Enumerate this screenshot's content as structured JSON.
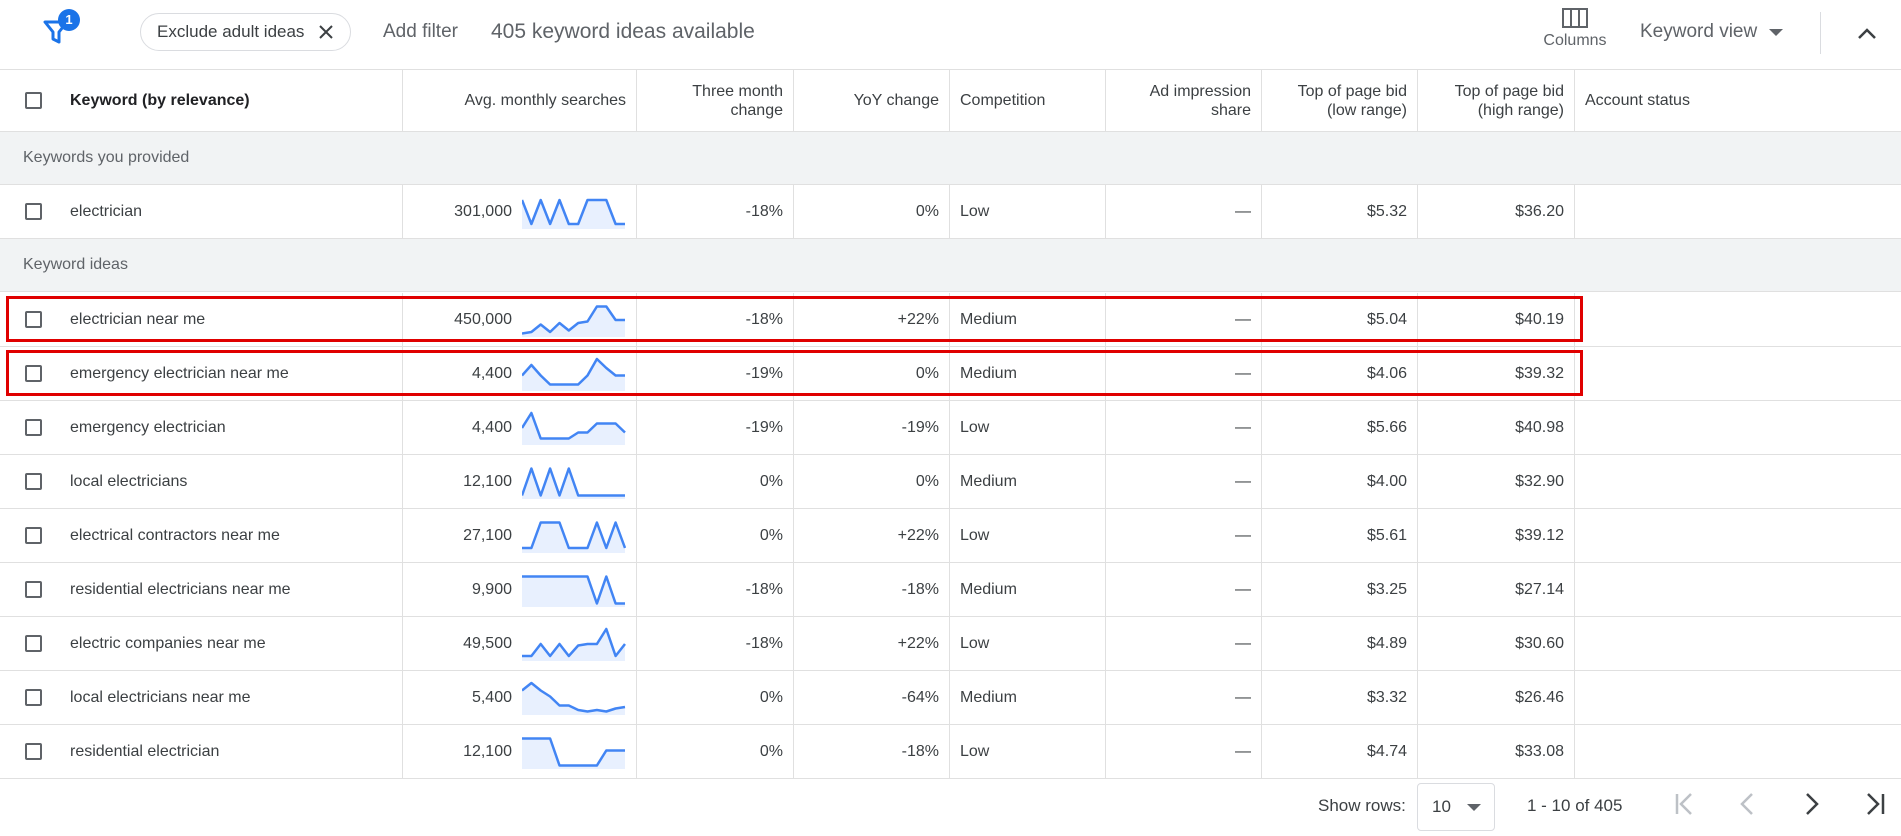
{
  "filterbar": {
    "badge_count": "1",
    "chip_label": "Exclude adult ideas",
    "add_filter": "Add filter",
    "available": "405 keyword ideas available",
    "columns_label": "Columns",
    "keyword_view": "Keyword view"
  },
  "columns": {
    "keyword": "Keyword (by relevance)",
    "avg_searches": "Avg. monthly searches",
    "three_month": "Three month change",
    "yoy": "YoY change",
    "competition": "Competition",
    "ad_impression": "Ad impression share",
    "bid_low": "Top of page bid (low range)",
    "bid_high": "Top of page bid (high range)",
    "account_status": "Account status"
  },
  "sections": {
    "provided": "Keywords you provided",
    "ideas": "Keyword ideas"
  },
  "provided_rows": [
    {
      "keyword": "electrician",
      "searches": "301,000",
      "three_month": "-18%",
      "yoy": "0%",
      "competition": "Low",
      "ad_share": "—",
      "bid_low": "$5.32",
      "bid_high": "$36.20",
      "trend": [
        0.9,
        0.1,
        0.9,
        0.1,
        0.9,
        0.1,
        0.1,
        0.9,
        0.9,
        0.9,
        0.1,
        0.1
      ],
      "highlighted": false
    }
  ],
  "idea_rows": [
    {
      "keyword": "electrician near me",
      "searches": "450,000",
      "three_month": "-18%",
      "yoy": "+22%",
      "competition": "Medium",
      "ad_share": "—",
      "bid_low": "$5.04",
      "bid_high": "$40.19",
      "trend": [
        0.05,
        0.1,
        0.35,
        0.1,
        0.4,
        0.15,
        0.4,
        0.45,
        0.95,
        0.95,
        0.5,
        0.5
      ],
      "highlighted": true
    },
    {
      "keyword": "emergency electrician near me",
      "searches": "4,400",
      "three_month": "-19%",
      "yoy": "0%",
      "competition": "Medium",
      "ad_share": "—",
      "bid_low": "$4.06",
      "bid_high": "$39.32",
      "trend": [
        0.45,
        0.8,
        0.45,
        0.15,
        0.15,
        0.15,
        0.15,
        0.45,
        1.0,
        0.7,
        0.45,
        0.45
      ],
      "highlighted": true
    },
    {
      "keyword": "emergency electrician",
      "searches": "4,400",
      "three_month": "-19%",
      "yoy": "-19%",
      "competition": "Low",
      "ad_share": "—",
      "bid_low": "$5.66",
      "bid_high": "$40.98",
      "trend": [
        0.5,
        1.0,
        0.15,
        0.15,
        0.15,
        0.15,
        0.35,
        0.35,
        0.65,
        0.65,
        0.65,
        0.35
      ],
      "highlighted": false
    },
    {
      "keyword": "local electricians",
      "searches": "12,100",
      "three_month": "0%",
      "yoy": "0%",
      "competition": "Medium",
      "ad_share": "—",
      "bid_low": "$4.00",
      "bid_high": "$32.90",
      "trend": [
        0.05,
        0.95,
        0.05,
        0.95,
        0.05,
        0.95,
        0.05,
        0.05,
        0.05,
        0.05,
        0.05,
        0.05
      ],
      "highlighted": false
    },
    {
      "keyword": "electrical contractors near me",
      "searches": "27,100",
      "three_month": "0%",
      "yoy": "+22%",
      "competition": "Low",
      "ad_share": "—",
      "bid_low": "$5.61",
      "bid_high": "$39.12",
      "trend": [
        0.1,
        0.1,
        0.95,
        0.95,
        0.95,
        0.1,
        0.1,
        0.1,
        0.95,
        0.1,
        0.95,
        0.1
      ],
      "highlighted": false
    },
    {
      "keyword": "residential electricians near me",
      "searches": "9,900",
      "three_month": "-18%",
      "yoy": "-18%",
      "competition": "Medium",
      "ad_share": "—",
      "bid_low": "$3.25",
      "bid_high": "$27.14",
      "trend": [
        0.95,
        0.95,
        0.95,
        0.95,
        0.95,
        0.95,
        0.95,
        0.95,
        0.05,
        0.95,
        0.05,
        0.05
      ],
      "highlighted": false
    },
    {
      "keyword": "electric companies near me",
      "searches": "49,500",
      "three_month": "-18%",
      "yoy": "+22%",
      "competition": "Low",
      "ad_share": "—",
      "bid_low": "$4.89",
      "bid_high": "$30.60",
      "trend": [
        0.1,
        0.1,
        0.5,
        0.1,
        0.5,
        0.1,
        0.45,
        0.5,
        0.5,
        1.0,
        0.1,
        0.5
      ],
      "highlighted": false
    },
    {
      "keyword": "local electricians near me",
      "searches": "5,400",
      "three_month": "0%",
      "yoy": "-64%",
      "competition": "Medium",
      "ad_share": "—",
      "bid_low": "$3.32",
      "bid_high": "$26.46",
      "trend": [
        0.75,
        1.0,
        0.75,
        0.55,
        0.25,
        0.25,
        0.1,
        0.05,
        0.1,
        0.05,
        0.15,
        0.2
      ],
      "highlighted": false
    },
    {
      "keyword": "residential electrician",
      "searches": "12,100",
      "three_month": "0%",
      "yoy": "-18%",
      "competition": "Low",
      "ad_share": "—",
      "bid_low": "$4.74",
      "bid_high": "$33.08",
      "trend": [
        0.95,
        0.95,
        0.95,
        0.95,
        0.05,
        0.05,
        0.05,
        0.05,
        0.05,
        0.55,
        0.55,
        0.55
      ],
      "highlighted": false
    }
  ],
  "footer": {
    "show_rows": "Show rows:",
    "rows_value": "10",
    "range": "1 - 10 of 405"
  },
  "colors": {
    "spark_line": "#4285f4",
    "spark_fill": "#e8f0fe",
    "highlight_box": "#e00000",
    "badge": "#1a73e8"
  }
}
